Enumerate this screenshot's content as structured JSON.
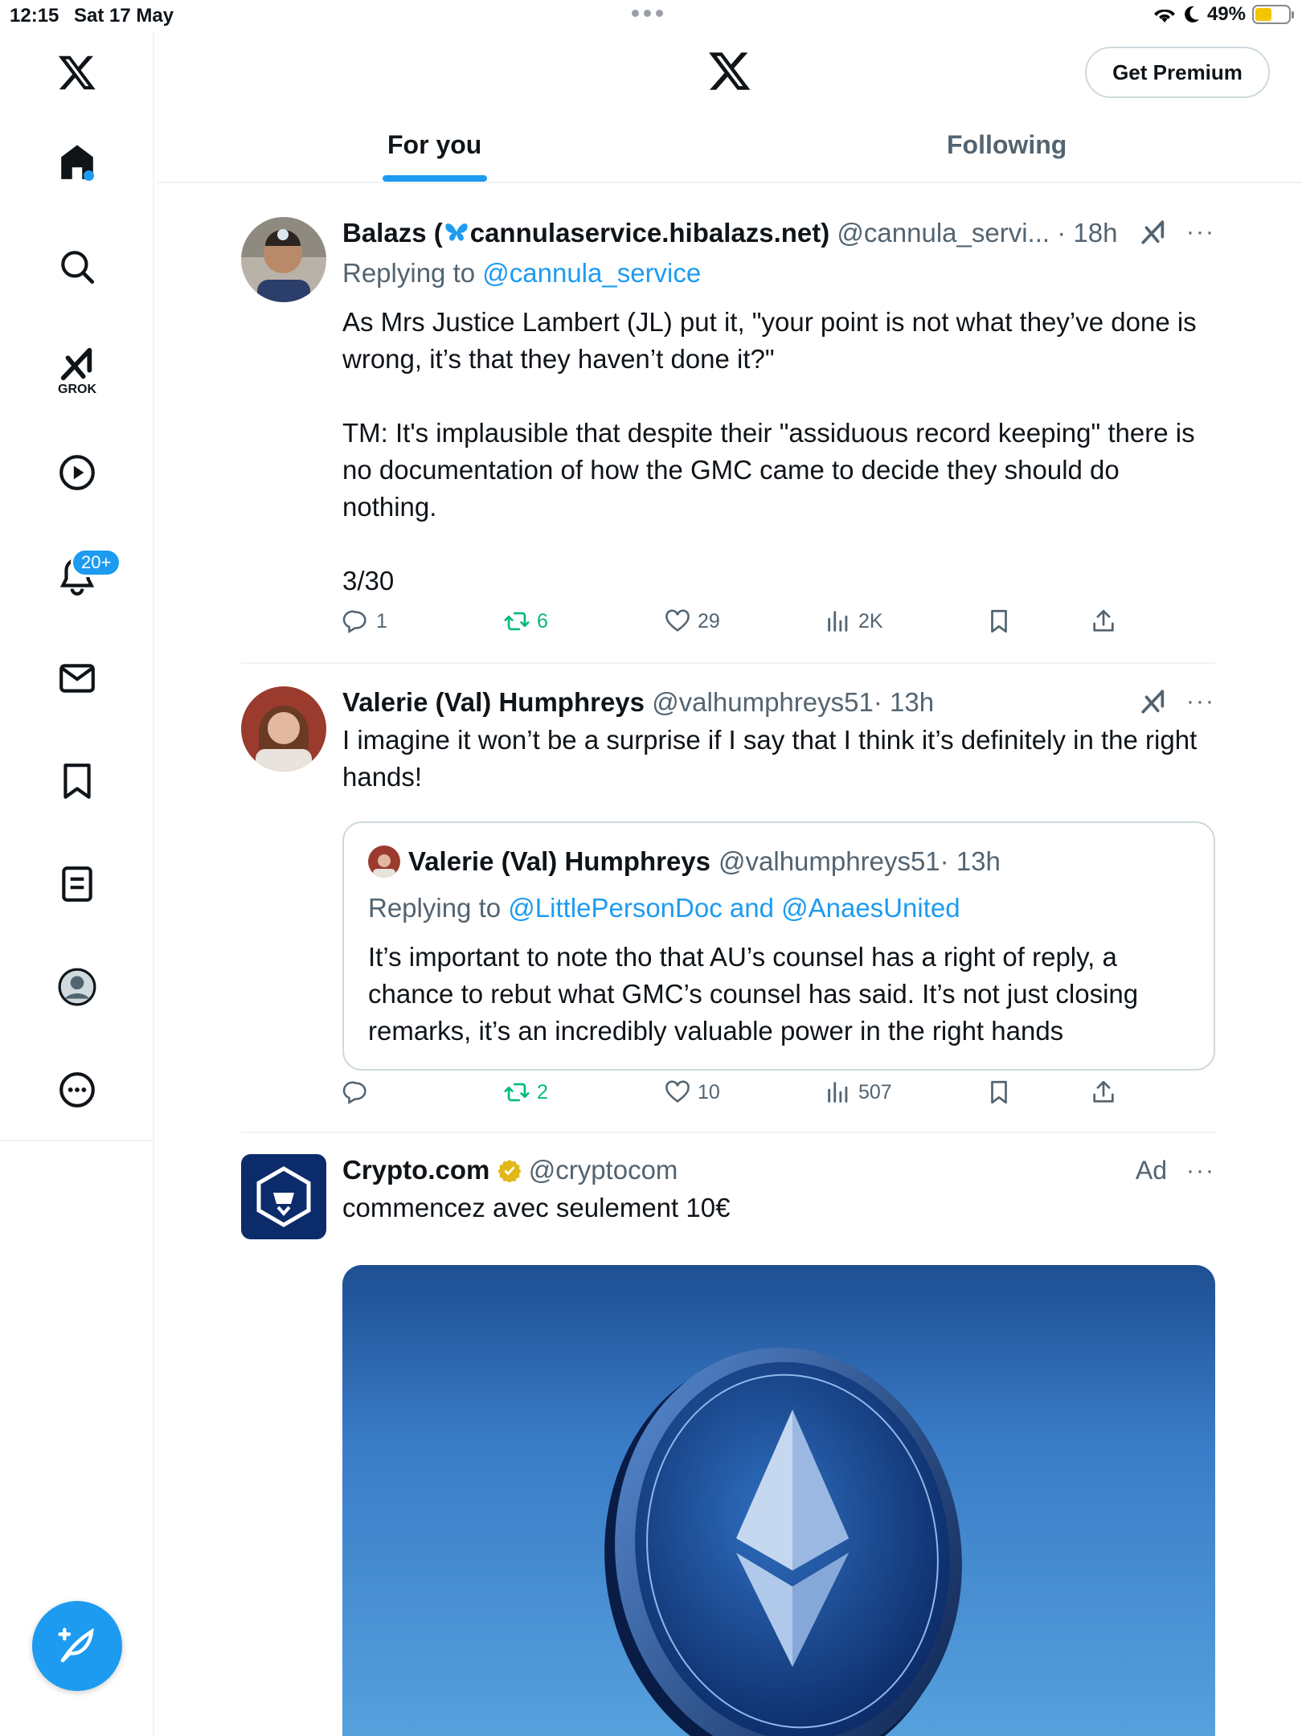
{
  "status_bar": {
    "time": "12:15",
    "date": "Sat 17 May",
    "battery": "49%",
    "battery_level": 0.49
  },
  "header": {
    "get_premium": "Get Premium",
    "tabs": [
      {
        "label": "For you"
      },
      {
        "label": "Following"
      }
    ]
  },
  "sidebar": {
    "items": [
      "x-logo-icon",
      "home-icon",
      "search-icon",
      "grok-icon",
      "video-icon",
      "notifications-icon",
      "messages-icon",
      "bookmarks-icon",
      "lists-icon",
      "profile-icon",
      "more-icon"
    ],
    "grok_label": "GROK",
    "notifications_badge": "20+"
  },
  "tweets": [
    {
      "name_prefix": "Balazs (",
      "name_suffix": "cannulaservice.hibalazs.net)",
      "handle": "@cannula_servi...",
      "time": "· 18h",
      "replying_label": "Replying to ",
      "replying_to": "@cannula_service",
      "text": "As Mrs Justice Lambert (JL) put it, \"your point is not what they’ve done is wrong, it’s that they haven’t done it?\"\n\nTM: It's implausible that despite their \"assiduous record keeping\" there is no documentation of how the GMC came to decide they should do nothing.\n\n3/30",
      "replies": "1",
      "reposts": "6",
      "likes": "29",
      "views": "2K"
    },
    {
      "name": "Valerie (Val) Humphreys",
      "handle": "@valhumphreys51",
      "time": "· 13h",
      "text": "I imagine it won’t be a surprise if I say that I think it’s definitely in the right hands!",
      "quote": {
        "name": "Valerie (Val) Humphreys",
        "handle": "@valhumphreys51",
        "time": "· 13h",
        "replying_label": "Replying to ",
        "replying_to": "@LittlePersonDoc and @AnaesUnited",
        "text": "It’s important to note tho that AU’s counsel has a right of reply, a chance to rebut what GMC’s counsel has said. It’s not just closing remarks, it’s an incredibly valuable power in the right hands"
      },
      "replies": "",
      "reposts": "2",
      "likes": "10",
      "views": "507"
    },
    {
      "name": "Crypto.com",
      "handle": "@cryptocom",
      "ad_label": "Ad",
      "text": "commencez avec seulement 10€"
    }
  ],
  "colors": {
    "accent": "#1d9bf0",
    "repost": "#00ba7c",
    "secondary": "#536471",
    "verified": "#e2b719"
  }
}
